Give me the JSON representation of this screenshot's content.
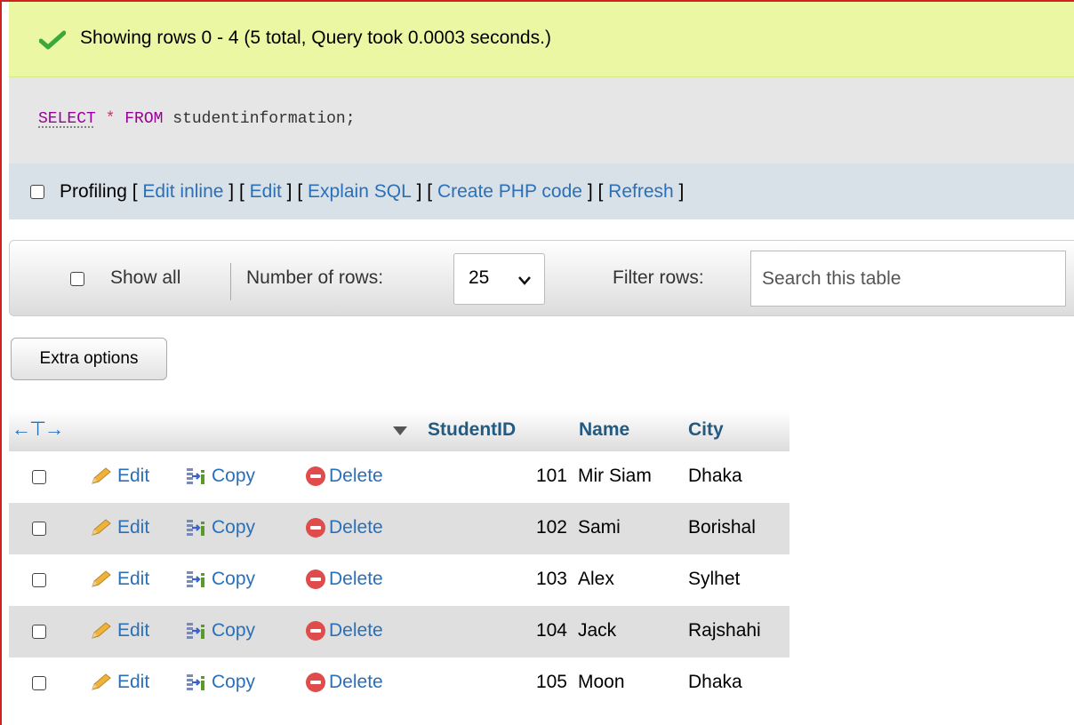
{
  "banner": {
    "message": "Showing rows 0 - 4 (5 total, Query took 0.0003 seconds.)"
  },
  "sql": {
    "select": "SELECT",
    "star": "*",
    "from": "FROM",
    "rest": "studentinformation;"
  },
  "profiling": {
    "label": "Profiling",
    "links": [
      "Edit inline",
      "Edit",
      "Explain SQL",
      "Create PHP code",
      "Refresh"
    ]
  },
  "nav": {
    "show_all": "Show all",
    "number_of_rows_label": "Number of rows:",
    "rows_value": "25",
    "filter_label": "Filter rows:",
    "search_placeholder": "Search this table"
  },
  "extra_options": "Extra options",
  "table": {
    "headers": [
      "StudentID",
      "Name",
      "City"
    ],
    "actions": {
      "edit": "Edit",
      "copy": "Copy",
      "delete": "Delete"
    },
    "rows": [
      {
        "id": "101",
        "name": "Mir Siam",
        "city": "Dhaka"
      },
      {
        "id": "102",
        "name": "Sami",
        "city": "Borishal"
      },
      {
        "id": "103",
        "name": "Alex",
        "city": "Sylhet"
      },
      {
        "id": "104",
        "name": "Jack",
        "city": "Rajshahi"
      },
      {
        "id": "105",
        "name": "Moon",
        "city": "Dhaka"
      }
    ]
  },
  "colors": {
    "banner_bg": "#ebf7a3",
    "link": "#2a70b8",
    "header_text": "#235a81",
    "delete": "#e04b4b"
  }
}
